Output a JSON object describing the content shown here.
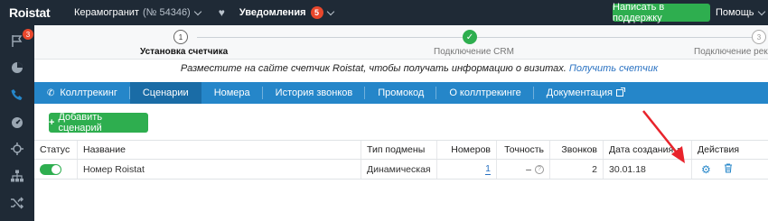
{
  "topbar": {
    "logo": "Roistat",
    "project_name": "Керамогранит",
    "project_id": "(№ 54346)",
    "notifications_label": "Уведомления",
    "notifications_count": "5",
    "support_button": "Написать в поддержку",
    "help_label": "Помощь"
  },
  "sidebar": {
    "badge": "3",
    "icons": [
      "flag-icon",
      "pie-chart-icon",
      "phone-icon",
      "dashboard-icon",
      "crosshair-icon",
      "sitemap-icon",
      "shuffle-icon"
    ],
    "accent": "#2586c9"
  },
  "steps": [
    {
      "number": "1",
      "label": "Установка счетчика",
      "state": "active"
    },
    {
      "number": "✓",
      "label": "Подключение CRM",
      "state": "done"
    },
    {
      "number": "3",
      "label": "Подключение рекла",
      "state": "todo"
    }
  ],
  "info": {
    "text": "Разместите на сайте счетчик Roistat, чтобы получать информацию о визитах.",
    "link": "Получить счетчик"
  },
  "tabs": [
    {
      "label": "Коллтрекинг",
      "active": false
    },
    {
      "label": "Сценарии",
      "active": true
    },
    {
      "label": "Номера",
      "active": false
    },
    {
      "label": "История звонков",
      "active": false
    },
    {
      "label": "Промокод",
      "active": false
    },
    {
      "label": "О коллтрекинге",
      "active": false
    },
    {
      "label": "Документация",
      "active": false
    }
  ],
  "add_button": "Добавить сценарий",
  "table": {
    "headers": {
      "status": "Статус",
      "name": "Название",
      "type": "Тип подмены",
      "numbers": "Номеров",
      "accuracy": "Точность",
      "calls": "Звонков",
      "date": "Дата создания",
      "actions": "Действия"
    },
    "rows": [
      {
        "status": "on",
        "name": "Номер Roistat",
        "type": "Динамическая",
        "numbers": "1",
        "accuracy": "–",
        "calls": "2",
        "date": "30.01.18"
      }
    ]
  },
  "colors": {
    "dark": "#1f2a36",
    "green": "#2eae4f",
    "blue": "#2586c9",
    "badge_red": "#e8472c",
    "annotation": "#e8232b"
  }
}
